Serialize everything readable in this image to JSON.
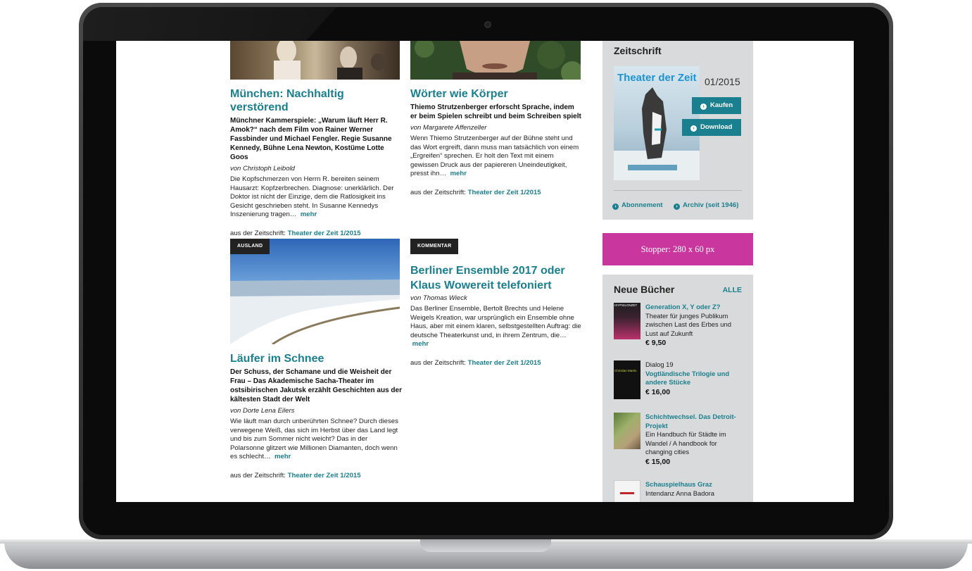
{
  "colors": {
    "accent": "#1a7f8e",
    "stopper": "#c8369e",
    "sidebar_bg": "#d9dadb",
    "tag_bg": "#222222"
  },
  "articles": [
    {
      "title": "München: Nachhaltig verstörend",
      "lead": "Münchner Kammerspiele: „Warum läuft Herr R. Amok?“ nach dem Film von Rainer Werner Fassbinder und Michael Fengler. Regie Susanne Kennedy, Bühne Lena Newton, Kostüme Lotte Goos",
      "author": "von Christoph Leibold",
      "body": "Die Kopfschmerzen von Herrn R. bereiten seinem Hausarzt: Kopfzerbrechen. Diagnose: unerklärlich. Der Doktor ist nicht der Einzige, dem die Ratlosigkeit ins Gesicht geschrieben steht. In Susanne Kennedys Inszenierung tragen…",
      "more": "mehr",
      "source_prefix": "aus der Zeitschrift:",
      "source_link": "Theater der Zeit 1/2015"
    },
    {
      "title": "Wörter wie Körper",
      "lead": "Thiemo Strutzenberger erforscht Sprache, indem er beim Spielen schreibt und beim Schreiben spielt",
      "author": "von Margarete Affenzeller",
      "body": "Wenn Thiemo Strutzenberger auf der Bühne steht und das Wort ergreift, dann muss man tatsächlich von einem „Ergreifen“ sprechen. Er holt den Text mit einem gewissen Druck aus der papiereren Uneindeutigkeit, presst ihn…",
      "more": "mehr",
      "source_prefix": "aus der Zeitschrift:",
      "source_link": "Theater der Zeit 1/2015"
    },
    {
      "tag": "AUSLAND",
      "title": "Läufer im Schnee",
      "lead": "Der Schuss, der Schamane und die Weisheit der Frau – Das Akademische Sacha-Theater im ostsibirischen Jakutsk erzählt Geschichten aus der kältesten Stadt der Welt",
      "author": "von Dorte Lena Eilers",
      "body": "Wie läuft man durch unberührten Schnee? Durch dieses verwegene Weiß, das sich im Herbst über das Land legt und bis zum Sommer nicht weicht? Das in der Polarsonne glitzert wie Millionen Diamanten, doch wenn es schlecht…",
      "more": "mehr",
      "source_prefix": "aus der Zeitschrift:",
      "source_link": "Theater der Zeit 1/2015"
    },
    {
      "tag": "KOMMENTAR",
      "title": "Berliner Ensemble 2017 oder Klaus Wowereit telefoniert",
      "author": "von Thomas Wieck",
      "body": "Das Berliner Ensemble, Bertolt Brechts und Helene Weigels Kreation, war ursprünglich ein Ensemble ohne Haus, aber mit einem klaren, selbstgestellten Auftrag: die deutsche Theaterkunst und, in ihrem Zentrum, die…",
      "more": "mehr",
      "source_prefix": "aus der Zeitschrift:",
      "source_link": "Theater der Zeit 1/2015"
    }
  ],
  "sidebar": {
    "magazine": {
      "title": "Zeitschrift",
      "issue": "01/2015",
      "cover_title": "Theater der Zeit",
      "buy": "Kaufen",
      "download": "Download",
      "subscription": "Abonnement",
      "archive": "Archiv (seit 1946)"
    },
    "stopper": "Stopper: 280 x 60 px",
    "books": {
      "title": "Neue Bücher",
      "all": "ALLE",
      "items": [
        {
          "title": "Generation X, Y oder Z?",
          "text": "Theater für junges Publikum zwischen Last des Erbes und Lust auf Zukunft",
          "price": "€ 9,50",
          "cover_label": "IXYPSILONZET"
        },
        {
          "pre": "Dialog 19",
          "title": "Vogtländische Trilogie und andere Stücke",
          "price": "€ 16,00",
          "cover_label": "Christian Martin"
        },
        {
          "title": "Schichtwechsel. Das Detroit-Projekt",
          "text": "Ein Handbuch für Städte im Wandel / A handbook for changing cities",
          "price": "€ 15,00"
        },
        {
          "title": "Schauspielhaus Graz",
          "text": "Intendanz Anna Badora"
        }
      ]
    }
  }
}
